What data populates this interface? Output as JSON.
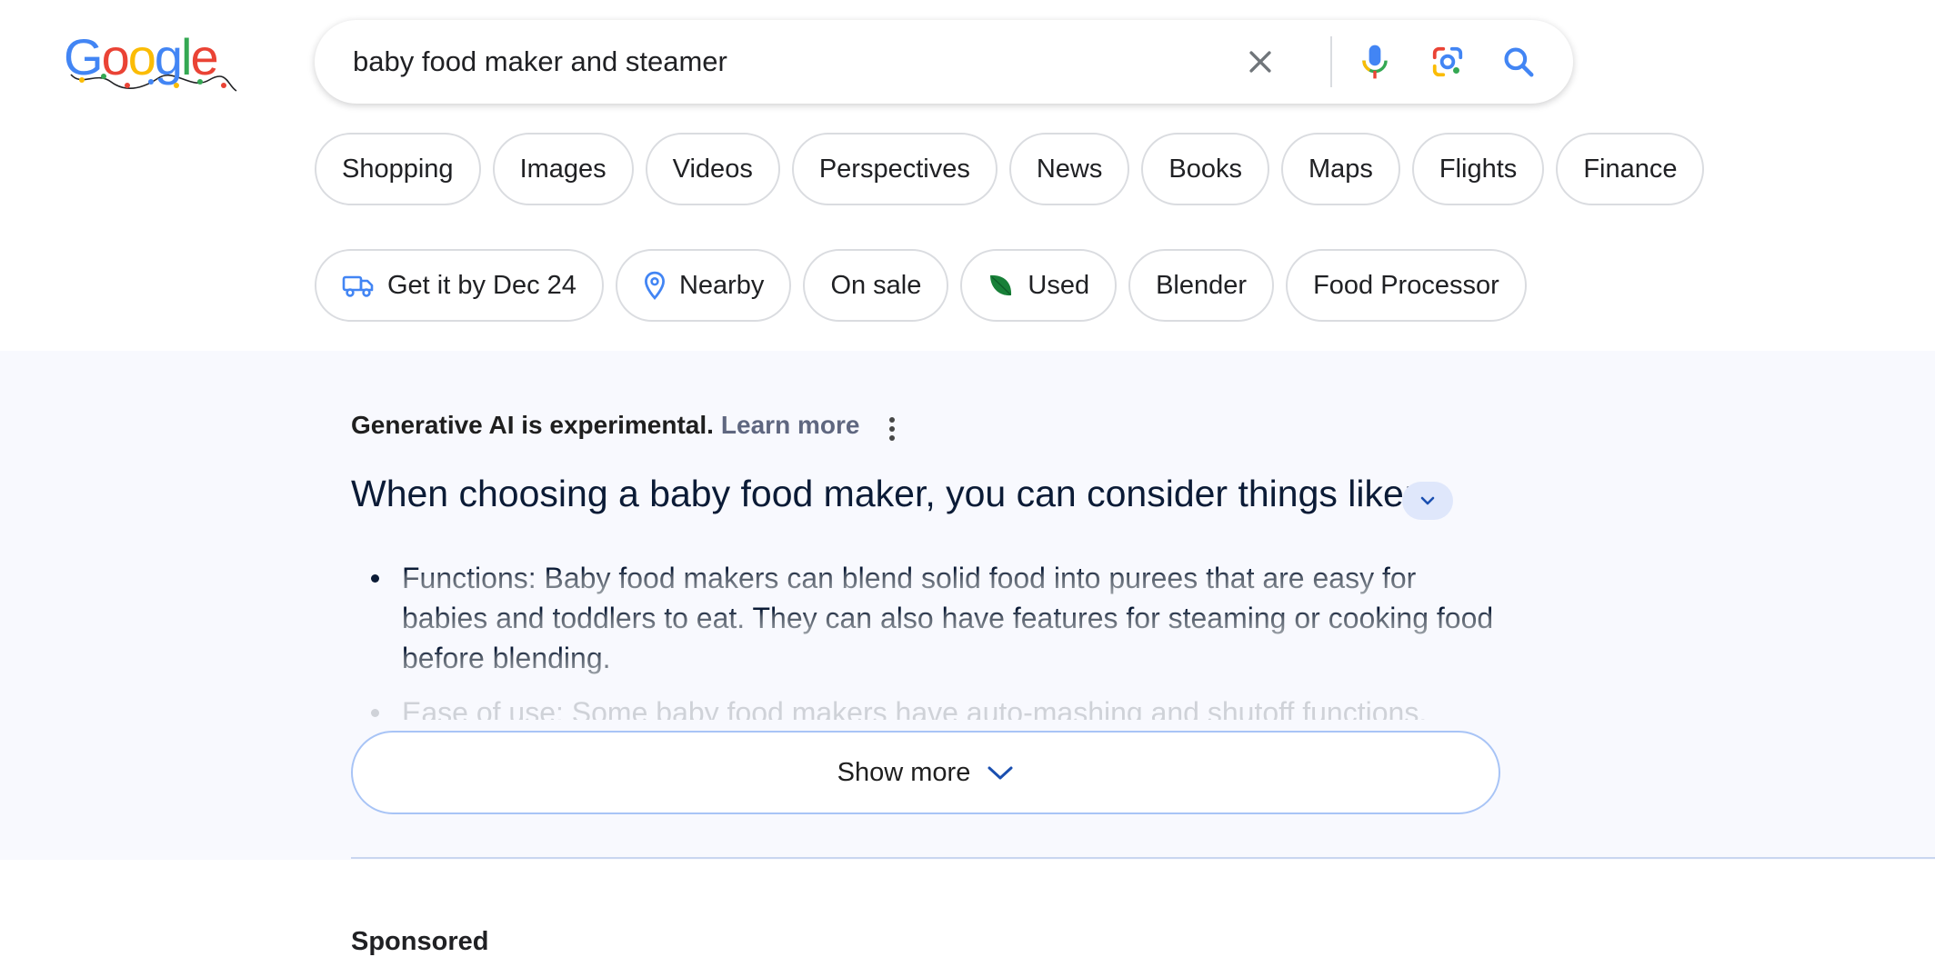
{
  "search": {
    "query": "baby food maker and steamer",
    "clear_icon": "close-icon",
    "mic_icon": "microphone-icon",
    "lens_icon": "google-lens-icon",
    "search_icon": "search-icon"
  },
  "tabs": [
    {
      "label": "Shopping"
    },
    {
      "label": "Images"
    },
    {
      "label": "Videos"
    },
    {
      "label": "Perspectives"
    },
    {
      "label": "News"
    },
    {
      "label": "Books"
    },
    {
      "label": "Maps"
    },
    {
      "label": "Flights"
    },
    {
      "label": "Finance"
    }
  ],
  "filters": [
    {
      "label": "Get it by Dec 24",
      "icon": "delivery-truck-icon"
    },
    {
      "label": "Nearby",
      "icon": "location-pin-icon"
    },
    {
      "label": "On sale"
    },
    {
      "label": "Used",
      "icon": "leaf-icon"
    },
    {
      "label": "Blender"
    },
    {
      "label": "Food Processor"
    }
  ],
  "ai_overview": {
    "disclaimer": "Generative AI is experimental.",
    "learn_more": "Learn more",
    "heading": "When choosing a baby food maker, you can consider things like:",
    "bullets": [
      "Functions: Baby food makers can blend solid food into purees that are easy for babies and toddlers to eat. They can also have features for steaming or cooking food before blending.",
      "Ease of use: Some baby food makers have auto-mashing and shutoff functions."
    ],
    "show_more": "Show more"
  },
  "sponsored_label": "Sponsored",
  "colors": {
    "accent_blue": "#4285f4",
    "link_gray": "#5f6780",
    "panel_bg": "#f8f9fe",
    "chip_border": "#dadce0"
  }
}
